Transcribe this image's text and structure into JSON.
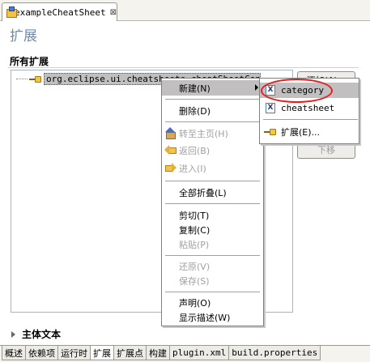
{
  "editor": {
    "tab_title": "exampleCheatSheet",
    "close_symbol": "⊠"
  },
  "form": {
    "title": "扩展"
  },
  "section": {
    "title": "所有扩展"
  },
  "tree": {
    "item_label": "org.eclipse.ui.cheatsheets.cheatSheetContent"
  },
  "buttons": {
    "add_label": "添加(A)...",
    "movedown_label": "下移"
  },
  "context_menu": {
    "items": [
      {
        "label": "新建(N)",
        "enabled": true,
        "submenu": true
      },
      {
        "label": "删除(D)",
        "enabled": true
      },
      {
        "label": "转至主页(H)",
        "enabled": false,
        "icon": "home-icon"
      },
      {
        "label": "返回(B)",
        "enabled": false,
        "icon": "back-arrow-icon"
      },
      {
        "label": "进入(I)",
        "enabled": false,
        "icon": "forward-arrow-icon"
      },
      {
        "label": "全部折叠(L)",
        "enabled": true
      },
      {
        "label": "剪切(T)",
        "enabled": true
      },
      {
        "label": "复制(C)",
        "enabled": true
      },
      {
        "label": "粘贴(P)",
        "enabled": false
      },
      {
        "label": "还原(V)",
        "enabled": false
      },
      {
        "label": "保存(S)",
        "enabled": false
      },
      {
        "label": "声明(O)",
        "enabled": true
      },
      {
        "label": "显示描述(W)",
        "enabled": true
      }
    ]
  },
  "submenu": {
    "items": [
      {
        "label": "category",
        "icon": "xml-element-icon",
        "highlighted": true
      },
      {
        "label": "cheatsheet",
        "icon": "xml-element-icon"
      },
      {
        "label": "扩展(E)...",
        "icon": "extension-icon"
      }
    ]
  },
  "body_section": {
    "title": "主体文本"
  },
  "page_tabs": [
    "概述",
    "依赖项",
    "运行时",
    "扩展",
    "扩展点",
    "构建",
    "plugin.xml",
    "build.properties"
  ],
  "colors": {
    "highlight": "#c1bfc0",
    "annotation_red": "#e81c1c",
    "form_title": "#6e8bb0"
  }
}
